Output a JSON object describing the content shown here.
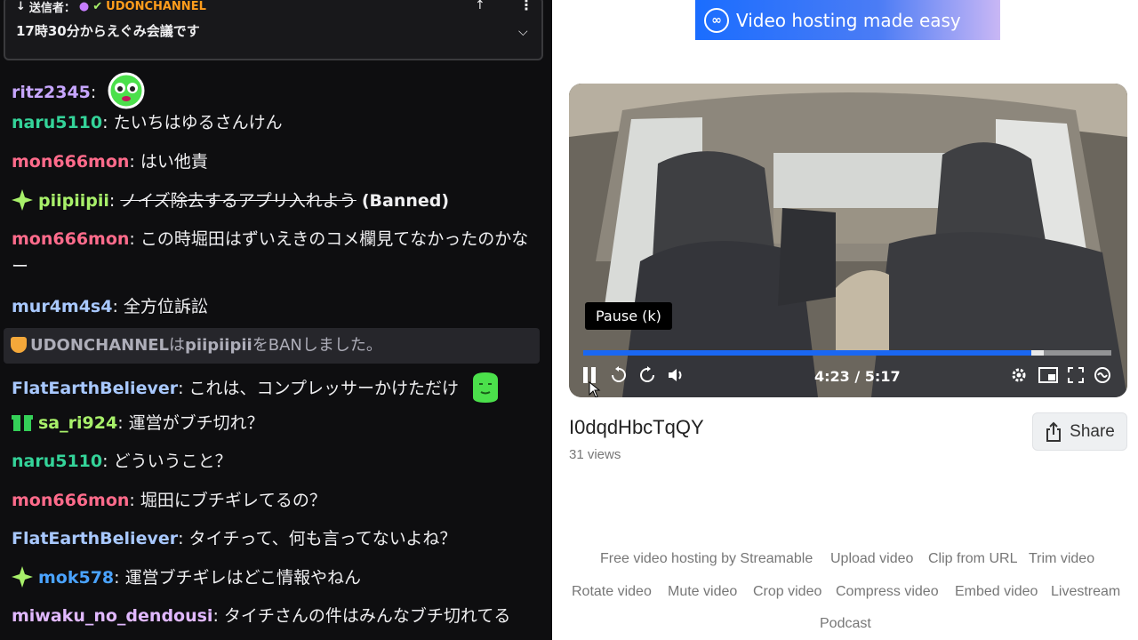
{
  "pinned": {
    "sender_label": "送信者：",
    "sender_name": "UDONCHANNEL",
    "message": "17時30分からえぐみ会議です"
  },
  "chat": [
    {
      "user": "ritz2345",
      "color": "#c7a6ff",
      "sep": ":",
      "text": "",
      "emote": "green-face-emote"
    },
    {
      "user": "naru5110",
      "color": "#34d399",
      "sep": ":",
      "text": " たいちはゆるさんけん"
    },
    {
      "user": "mon666mon",
      "color": "#ff6b8b",
      "sep": ":",
      "text": " はい他責"
    },
    {
      "user": "piipiipii",
      "color": "#a8f06a",
      "sep": ":",
      "text": "ノイズ除去するアプリ入れよう",
      "suffix": "(Banned)"
    },
    {
      "user": "mon666mon",
      "color": "#ff6b8b",
      "sep": ":",
      "text": " この時堀田はずいえきのコメ欄見てなかったのかなー"
    },
    {
      "user": "mur4m4s4",
      "color": "#a8c8ff",
      "sep": ":",
      "text": " 全方位訴訟"
    },
    {
      "user": "FlatEarthBeliever",
      "color": "#a8c8ff",
      "sep": ":",
      "text": " これは、コンプレッサーかけただけ"
    },
    {
      "user": "sa_ri924",
      "color": "#a8f06a",
      "sep": ":",
      "text": " 運営がブチ切れ？"
    },
    {
      "user": "naru5110",
      "color": "#34d399",
      "sep": ":",
      "text": " どういうこと？"
    },
    {
      "user": "mon666mon",
      "color": "#ff6b8b",
      "sep": ":",
      "text": " 堀田にブチギレてるの？"
    },
    {
      "user": "FlatEarthBeliever",
      "color": "#a8c8ff",
      "sep": ":",
      "text": " タイチって、何も言ってないよね？"
    },
    {
      "user": "mok578",
      "color": "#4aa3ff",
      "sep": ":",
      "text": " 運営ブチギレはどこ情報やねん"
    },
    {
      "user": "miwaku_no_dendousi",
      "color": "#e0b8ff",
      "sep": ":",
      "text": " タイチさんの件はみんなブチ切れてる"
    }
  ],
  "system_msg": {
    "mod": "UDONCHANNEL",
    "mid": "は",
    "target": "piipiipii",
    "tail": "をBANしました。"
  },
  "banner": {
    "text": "Video hosting made easy"
  },
  "player": {
    "tooltip": "Pause (k)",
    "time": "4:23 / 5:17",
    "progress": 0.848,
    "buffered": 0.872
  },
  "video": {
    "title": "I0dqdHbcTqQY",
    "views": "31 views"
  },
  "share_label": "Share",
  "footer": {
    "row1": [
      "Free video hosting by Streamable",
      "Upload video",
      "Clip from URL",
      "Trim video"
    ],
    "row2": [
      "Rotate video",
      "Mute video",
      "Crop video",
      "Compress video",
      "Embed video",
      "Livestream"
    ],
    "row3": [
      "Podcast"
    ]
  }
}
